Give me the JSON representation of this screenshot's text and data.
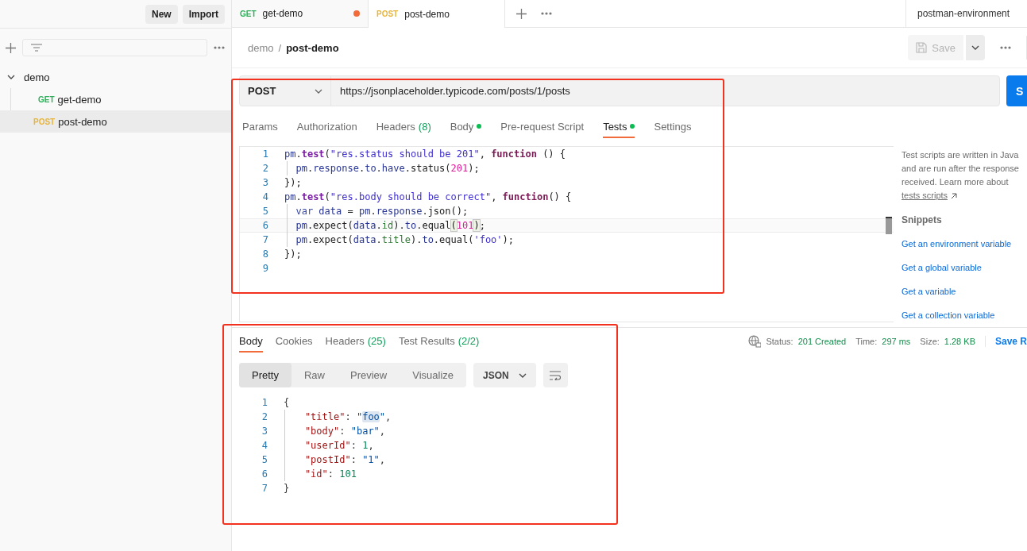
{
  "sidebar": {
    "buttons": [
      "New",
      "Import"
    ],
    "tree": [
      {
        "label": "demo",
        "expanded": true,
        "selected": false,
        "children": [
          {
            "method": "GET",
            "color": "#2cb05a",
            "label": "get-demo",
            "selected": false
          },
          {
            "method": "POST",
            "color": "#e8b53a",
            "label": "post-demo",
            "selected": true
          }
        ]
      }
    ]
  },
  "tabs": [
    {
      "method": "GET",
      "color": "#2cb05a",
      "label": "get-demo",
      "unsaved": true,
      "selected": false
    },
    {
      "method": "POST",
      "color": "#e8b53a",
      "label": "post-demo",
      "unsaved": false,
      "selected": true
    }
  ],
  "environment": "postman-environment",
  "breadcrumb": {
    "parent": "demo",
    "separator": "/",
    "current": "post-demo"
  },
  "save_button": {
    "label": "Save",
    "disabled": true
  },
  "request": {
    "method": "POST",
    "url": "https://jsonplaceholder.typicode.com/posts/1/posts",
    "send_label": "S",
    "tabs": [
      {
        "label": "Params",
        "selected": false,
        "dot": false
      },
      {
        "label": "Authorization",
        "selected": false,
        "dot": false
      },
      {
        "label": "Headers",
        "count": "(8)",
        "selected": false,
        "dot": false
      },
      {
        "label": "Body",
        "selected": false,
        "dot": true
      },
      {
        "label": "Pre-request Script",
        "selected": false,
        "dot": false
      },
      {
        "label": "Tests",
        "selected": true,
        "dot": true
      },
      {
        "label": "Settings",
        "selected": false,
        "dot": false
      }
    ],
    "code": [
      {
        "number": "1",
        "guide": false,
        "current": false,
        "tokens": [
          {
            "kind": "obj",
            "text": "pm"
          },
          {
            "kind": "p",
            "text": "."
          },
          {
            "kind": "fn",
            "text": "test"
          },
          {
            "kind": "p",
            "text": "("
          },
          {
            "kind": "str",
            "text": "\"res.status should be 201\""
          },
          {
            "kind": "p",
            "text": ", "
          },
          {
            "kind": "kw",
            "text": "function"
          },
          {
            "kind": "p",
            "text": " () {"
          }
        ]
      },
      {
        "number": "2",
        "guide": true,
        "current": false,
        "tokens": [
          {
            "kind": "obj",
            "text": "pm"
          },
          {
            "kind": "p",
            "text": "."
          },
          {
            "kind": "obj",
            "text": "response"
          },
          {
            "kind": "p",
            "text": "."
          },
          {
            "kind": "obj",
            "text": "to"
          },
          {
            "kind": "p",
            "text": "."
          },
          {
            "kind": "obj",
            "text": "have"
          },
          {
            "kind": "p",
            "text": ".status("
          },
          {
            "kind": "num",
            "text": "201"
          },
          {
            "kind": "p",
            "text": ");"
          }
        ]
      },
      {
        "number": "3",
        "guide": false,
        "current": false,
        "tokens": [
          {
            "kind": "p",
            "text": "});"
          }
        ]
      },
      {
        "number": "4",
        "guide": false,
        "current": false,
        "tokens": [
          {
            "kind": "obj",
            "text": "pm"
          },
          {
            "kind": "p",
            "text": "."
          },
          {
            "kind": "fn",
            "text": "test"
          },
          {
            "kind": "p",
            "text": "("
          },
          {
            "kind": "str",
            "text": "\"res.body should be correct\""
          },
          {
            "kind": "p",
            "text": ", "
          },
          {
            "kind": "kw",
            "text": "function"
          },
          {
            "kind": "p",
            "text": "() {"
          }
        ]
      },
      {
        "number": "5",
        "guide": true,
        "current": false,
        "tokens": [
          {
            "kind": "var",
            "text": "var "
          },
          {
            "kind": "obj",
            "text": "data"
          },
          {
            "kind": "p",
            "text": " = "
          },
          {
            "kind": "obj",
            "text": "pm"
          },
          {
            "kind": "p",
            "text": "."
          },
          {
            "kind": "obj",
            "text": "response"
          },
          {
            "kind": "p",
            "text": ".json();"
          }
        ]
      },
      {
        "number": "6",
        "guide": true,
        "current": true,
        "tokens": [
          {
            "kind": "obj",
            "text": "pm"
          },
          {
            "kind": "p",
            "text": ".expect("
          },
          {
            "kind": "obj",
            "text": "data"
          },
          {
            "kind": "p",
            "text": "."
          },
          {
            "kind": "field",
            "text": "id"
          },
          {
            "kind": "p",
            "text": ")."
          },
          {
            "kind": "obj",
            "text": "to"
          },
          {
            "kind": "p",
            "text": ".equal"
          },
          {
            "kind": "bm",
            "text": "("
          },
          {
            "kind": "num",
            "text": "101"
          },
          {
            "kind": "bm",
            "text": ")"
          },
          {
            "kind": "p",
            "text": ";"
          }
        ]
      },
      {
        "number": "7",
        "guide": true,
        "current": false,
        "tokens": [
          {
            "kind": "obj",
            "text": "pm"
          },
          {
            "kind": "p",
            "text": ".expect("
          },
          {
            "kind": "obj",
            "text": "data"
          },
          {
            "kind": "p",
            "text": "."
          },
          {
            "kind": "field",
            "text": "title"
          },
          {
            "kind": "p",
            "text": ")."
          },
          {
            "kind": "obj",
            "text": "to"
          },
          {
            "kind": "p",
            "text": ".equal("
          },
          {
            "kind": "str",
            "text": "'foo'"
          },
          {
            "kind": "p",
            "text": ");"
          }
        ]
      },
      {
        "number": "8",
        "guide": false,
        "current": false,
        "tokens": [
          {
            "kind": "p",
            "text": "});"
          }
        ]
      },
      {
        "number": "9",
        "current": false
      }
    ],
    "help": {
      "lines": [
        "Test scripts are written in Java",
        "and are run after the response",
        "received. Learn more about"
      ],
      "link": "tests scripts",
      "snippets_title": "Snippets",
      "snippets": [
        "Get an environment variable",
        "Get a global variable",
        "Get a variable",
        "Get a collection variable"
      ]
    }
  },
  "response": {
    "tabs": [
      {
        "label": "Body",
        "selected": true
      },
      {
        "label": "Cookies",
        "selected": false
      },
      {
        "label": "Headers",
        "count": "(25)",
        "selected": false
      },
      {
        "label": "Test Results",
        "count": "(2/2)",
        "selected": false
      }
    ],
    "status": [
      {
        "label": "Status:",
        "value": "201 Created"
      },
      {
        "label": "Time:",
        "value": "297 ms"
      },
      {
        "label": "Size:",
        "value": "1.28 KB"
      }
    ],
    "save_label": "Save R",
    "views": [
      {
        "label": "Pretty",
        "selected": true
      },
      {
        "label": "Raw",
        "selected": false
      },
      {
        "label": "Preview",
        "selected": false
      },
      {
        "label": "Visualize",
        "selected": false
      }
    ],
    "format": "JSON",
    "code": [
      {
        "number": "1",
        "guide": false,
        "tokens": [
          {
            "kind": "p",
            "text": "{"
          }
        ]
      },
      {
        "number": "2",
        "guide": true,
        "tokens": [
          {
            "kind": "key",
            "text": "\"title\""
          },
          {
            "kind": "p",
            "text": ": "
          },
          {
            "kind": "str",
            "text": "\""
          },
          {
            "kind": "hl",
            "text": "foo"
          },
          {
            "kind": "str",
            "text": "\""
          },
          {
            "kind": "p",
            "text": ","
          }
        ]
      },
      {
        "number": "3",
        "guide": true,
        "tokens": [
          {
            "kind": "key",
            "text": "\"body\""
          },
          {
            "kind": "p",
            "text": ": "
          },
          {
            "kind": "str",
            "text": "\"bar\""
          },
          {
            "kind": "p",
            "text": ","
          }
        ]
      },
      {
        "number": "4",
        "guide": true,
        "tokens": [
          {
            "kind": "key",
            "text": "\"userId\""
          },
          {
            "kind": "p",
            "text": ": "
          },
          {
            "kind": "num",
            "text": "1"
          },
          {
            "kind": "p",
            "text": ","
          }
        ]
      },
      {
        "number": "5",
        "guide": true,
        "tokens": [
          {
            "kind": "key",
            "text": "\"postId\""
          },
          {
            "kind": "p",
            "text": ": "
          },
          {
            "kind": "str",
            "text": "\"1\""
          },
          {
            "kind": "p",
            "text": ","
          }
        ]
      },
      {
        "number": "6",
        "guide": true,
        "tokens": [
          {
            "kind": "key",
            "text": "\"id\""
          },
          {
            "kind": "p",
            "text": ": "
          },
          {
            "kind": "num",
            "text": "101"
          }
        ]
      },
      {
        "number": "7",
        "guide": false,
        "tokens": [
          {
            "kind": "p",
            "text": "}"
          }
        ]
      }
    ]
  },
  "annotation_frames": [
    {
      "color": "#f2321e"
    },
    {
      "color": "#f2321e"
    }
  ]
}
